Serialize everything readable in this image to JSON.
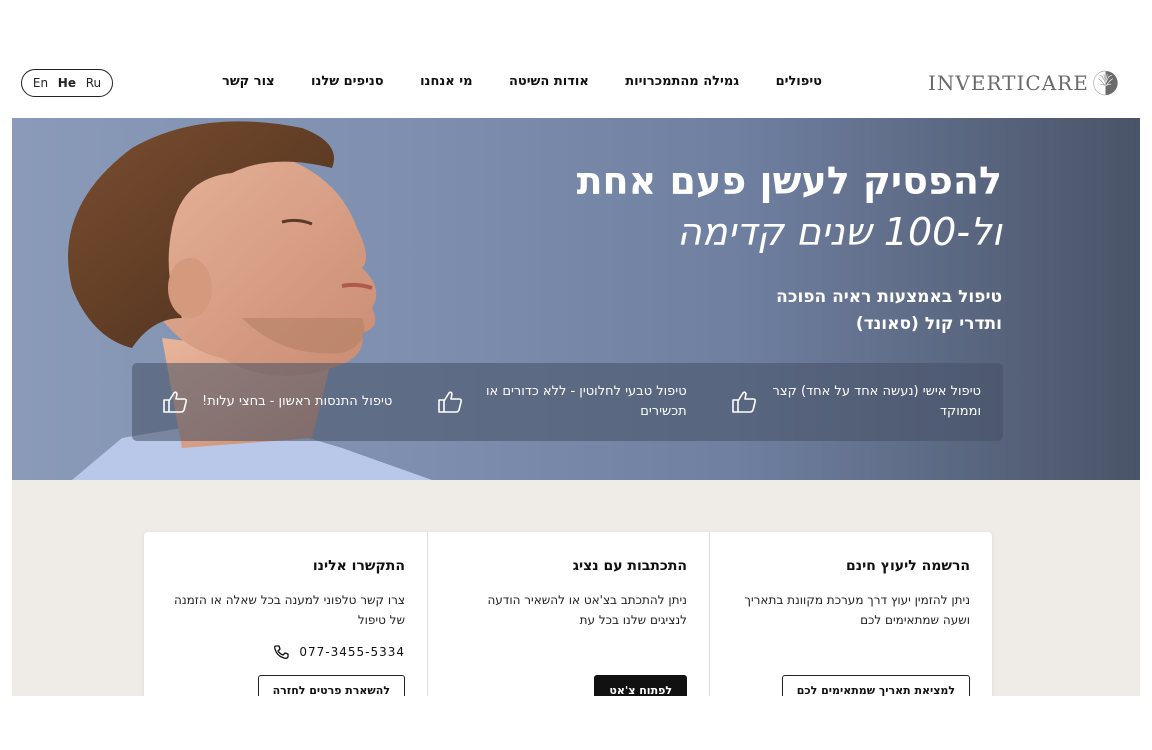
{
  "header": {
    "languages": [
      "En",
      "He",
      "Ru"
    ],
    "active_language": "He",
    "nav": [
      "טיפולים",
      "גמילה מהתמכרויות",
      "אודות השיטה",
      "מי אנחנו",
      "סניפים שלנו",
      "צור קשר"
    ],
    "logo_text": "INVERTICARE"
  },
  "hero": {
    "title_line1": "להפסיק לעשן פעם אחת",
    "title_line2": "ול-100 שנים קדימה",
    "subtitle_line1": "טיפול באמצעות ראיה הפוכה",
    "subtitle_line2": "ותדרי קול (סאונד)",
    "features": [
      {
        "icon": "thumbs-up-icon",
        "text": "טיפול אישי (נעשה אחד על אחד) קצר וממוקד"
      },
      {
        "icon": "thumbs-up-icon",
        "text": "טיפול טבעי לחלוטין - ללא כדורים או תכשירים"
      },
      {
        "icon": "thumbs-up-icon",
        "text": "טיפול התנסות ראשון - בחצי עלות!"
      }
    ]
  },
  "contact": {
    "columns": [
      {
        "title": "הרשמה ליעוץ חינם",
        "text": "ניתן להזמין יעוץ דרך מערכת מקוונת בתאריך ושעה שמתאימים לכם",
        "button": "למציאת תאריך שמתאימים לכם"
      },
      {
        "title": "התכתבות עם נציג",
        "text": "ניתן להתכתב בצ'אט או להשאיר הודעה לנציגים שלנו בכל עת",
        "button": "לפתוח צ'אט"
      },
      {
        "title": "התקשרו אלינו",
        "text": "צרו קשר טלפוני למענה בכל שאלה או הזמנה של טיפול",
        "phone": "077-3455-5334",
        "button": "להשארת פרטים לחזרה"
      }
    ]
  },
  "colors": {
    "hero_overlay": "#4a5468",
    "lower_bg": "#efebe7",
    "dark_button": "#111111"
  }
}
